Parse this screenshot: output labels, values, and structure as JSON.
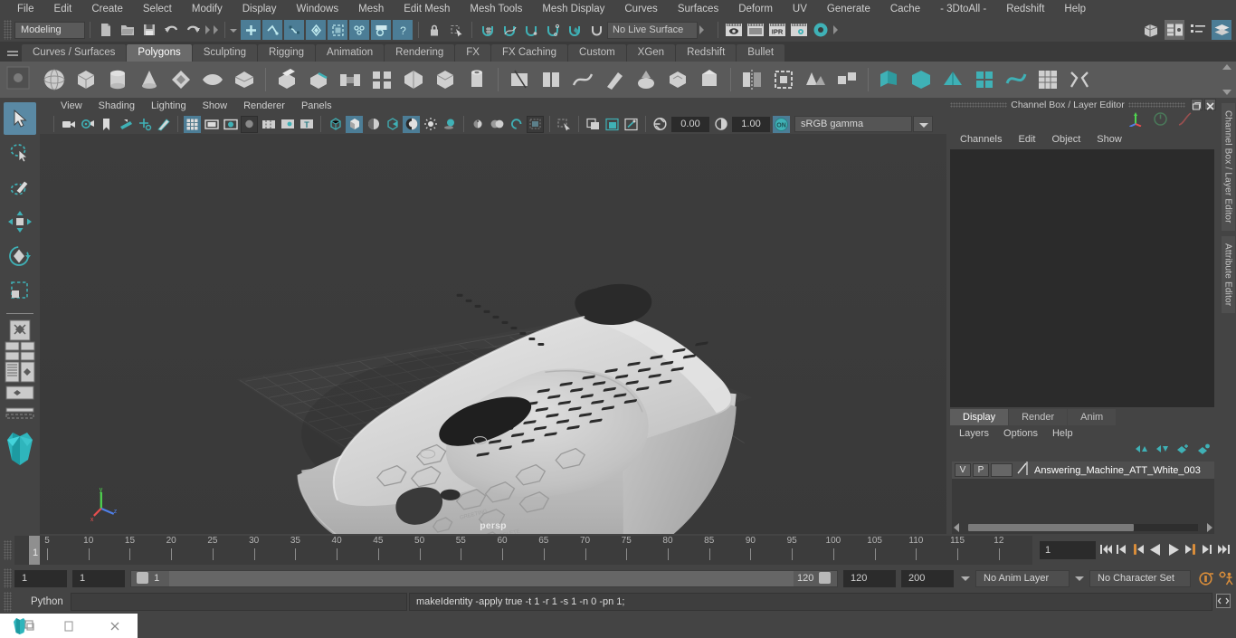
{
  "app": {
    "title": "Autodesk Maya"
  },
  "menubar": {
    "items": [
      "File",
      "Edit",
      "Create",
      "Select",
      "Modify",
      "Display",
      "Windows",
      "Mesh",
      "Edit Mesh",
      "Mesh Tools",
      "Mesh Display",
      "Curves",
      "Surfaces",
      "Deform",
      "UV",
      "Generate",
      "Cache",
      "- 3DtoAll -",
      "Redshift",
      "Help"
    ]
  },
  "statusline": {
    "menu_set": "Modeling",
    "live_surface": "No Live Surface",
    "icons_left": [
      "new-scene-icon",
      "open-scene-icon",
      "save-scene-icon",
      "undo-icon",
      "redo-icon"
    ],
    "select_mode_icons": [
      "select-by-hierarchy-icon",
      "select-by-object-icon",
      "select-by-component-icon"
    ],
    "mask_icons": [
      "handles-mask-icon",
      "component-mask-icon",
      "deform-mask-icon",
      "dynamics-mask-icon",
      "rendering-mask-icon",
      "misc-mask-icon"
    ],
    "lock_icons": [
      "lock-icon",
      "select-highlight-icon"
    ],
    "snap_icons": [
      "snap-to-grid-icon",
      "snap-to-curve-icon",
      "snap-to-point-icon",
      "snap-to-projected-center-icon",
      "snap-to-view-plane-icon",
      "make-live-icon"
    ],
    "render_icons": [
      "render-view-icon",
      "render-sequence-icon",
      "ipr-render-icon",
      "render-settings-icon",
      "hypershade-icon"
    ],
    "editor_icons": [
      "show-hide-modeling-panel-icon",
      "show-hide-attribute-editor-icon",
      "show-hide-tool-settings-icon",
      "show-hide-channel-box-icon"
    ]
  },
  "shelf": {
    "tabs": [
      "Curves / Surfaces",
      "Polygons",
      "Sculpting",
      "Rigging",
      "Animation",
      "Rendering",
      "FX",
      "FX Caching",
      "Custom",
      "XGen",
      "Redshift",
      "Bullet"
    ],
    "active_tab": "Polygons",
    "icons": [
      "poly-sphere-icon",
      "poly-cube-icon",
      "poly-cylinder-icon",
      "poly-cone-icon",
      "poly-torus-icon",
      "poly-plane-icon",
      "poly-pyramid-icon",
      "poly-prism-icon",
      "poly-pipe-icon",
      "poly-helix-icon",
      "poly-soccer-ball-icon",
      "poly-platonic-icon",
      "poly-gear-icon",
      "poly-type-icon",
      "poly-svg-icon",
      "sculpt-icon",
      "poly-extrude-icon",
      "poly-bevel-icon",
      "poly-bridge-icon",
      "poly-append-icon",
      "poly-wedge-icon",
      "poly-booleans-icon",
      "combine-icon",
      "separate-icon",
      "smooth-icon",
      "mirror-icon",
      "reduce-icon",
      "triangulate-icon",
      "quadrangulate-icon",
      "crease-icon",
      "multi-cut-icon",
      "target-weld-icon"
    ]
  },
  "toolbox": {
    "tools": [
      {
        "name": "select-tool",
        "active": true
      },
      {
        "name": "lasso-select-tool",
        "active": false
      },
      {
        "name": "paint-select-tool",
        "active": false
      },
      {
        "name": "move-tool",
        "active": false
      },
      {
        "name": "rotate-tool",
        "active": false
      },
      {
        "name": "scale-tool",
        "active": false
      }
    ],
    "layout_icons": [
      "single-perspective-view-icon",
      "four-view-layout-icon",
      "persp-outliner-layout-icon",
      "persp-graph-layout-icon",
      "hypershade-layout-icon"
    ]
  },
  "viewport": {
    "menus": [
      "View",
      "Shading",
      "Lighting",
      "Show",
      "Renderer",
      "Panels"
    ],
    "camera_label": "persp",
    "exposure": "0.00",
    "gamma": "1.00",
    "color_space": "sRGB gamma",
    "toolbar_icons": [
      "select-camera-icon",
      "camera-attributes-icon",
      "bookmark-icon",
      "image-plane-icon",
      "two-d-pan-zoom-icon",
      "grease-pencil-icon",
      "grid-toggle-icon",
      "film-gate-icon",
      "resolution-gate-icon",
      "gate-mask-icon",
      "film-origin-icon",
      "selection-highlight-icon",
      "texture-border-icon",
      "wireframe-icon",
      "smooth-shade-icon",
      "shaded-wireframe-icon",
      "flat-shade-icon",
      "textured-icon",
      "use-default-light-icon",
      "shadows-icon",
      "ambient-occlusion-icon",
      "motion-blur-icon",
      "multisample-icon",
      "isolate-select-icon",
      "xray-icon",
      "xray-joints-icon",
      "xray-active-components-icon",
      "exposure-icon",
      "gamma-icon",
      "view-transform-enabled-icon"
    ]
  },
  "channel_box": {
    "title": "Channel Box / Layer Editor",
    "menus": [
      "Channels",
      "Edit",
      "Object",
      "Show"
    ],
    "quick_icons": [
      "move-axis-icon",
      "speed-icon",
      "curve-icon"
    ],
    "window_buttons": [
      "undock-icon",
      "close-icon"
    ]
  },
  "layer_editor": {
    "tabs": [
      "Display",
      "Render",
      "Anim"
    ],
    "active_tab": "Display",
    "menus": [
      "Layers",
      "Options",
      "Help"
    ],
    "button_icons": [
      "move-layer-up-icon",
      "move-layer-down-icon",
      "new-layer-icon",
      "new-layer-from-selected-icon"
    ],
    "layers": [
      {
        "visibility": "V",
        "playback": "P",
        "color": "",
        "name": "Answering_Machine_ATT_White_003"
      }
    ]
  },
  "dock_tabs": [
    "Channel Box / Layer Editor",
    "Attribute Editor"
  ],
  "time_slider": {
    "tick_labels": [
      "5",
      "10",
      "15",
      "20",
      "25",
      "30",
      "35",
      "40",
      "45",
      "50",
      "55",
      "60",
      "65",
      "70",
      "75",
      "80",
      "85",
      "90",
      "95",
      "100",
      "105",
      "110",
      "115",
      "12"
    ],
    "current_frame_marker": "1",
    "current_frame_field": "1",
    "playback_icons": [
      "go-to-start-icon",
      "step-back-keyframe-icon",
      "step-back-frame-icon",
      "play-backwards-icon",
      "play-forwards-icon",
      "step-forward-frame-icon",
      "step-forward-keyframe-icon",
      "go-to-end-icon"
    ]
  },
  "range_slider": {
    "anim_start": "1",
    "playback_start": "1",
    "range_start_label": "1",
    "range_end_label": "120",
    "playback_end": "120",
    "anim_end": "200",
    "anim_layer": "No Anim Layer",
    "character_set": "No Character Set",
    "right_icons": [
      "auto-key-icon",
      "animation-preferences-icon"
    ]
  },
  "command_line": {
    "language": "Python",
    "input_value": "",
    "output_text": "makeIdentity -apply true -t 1 -r 1 -s 1 -n 0 -pn 1;",
    "script_editor_icon": "script-editor-icon"
  },
  "taskbar": {
    "items": [
      "maya-app-icon",
      "maximize-icon",
      "close-icon"
    ]
  },
  "colors": {
    "accent": "#4c7d96",
    "teal": "#3fb1b6",
    "panel_bg": "#444444",
    "dark_bg": "#2b2b2b",
    "orange": "#d98d3a",
    "active_tab": "#6b6b6b"
  }
}
